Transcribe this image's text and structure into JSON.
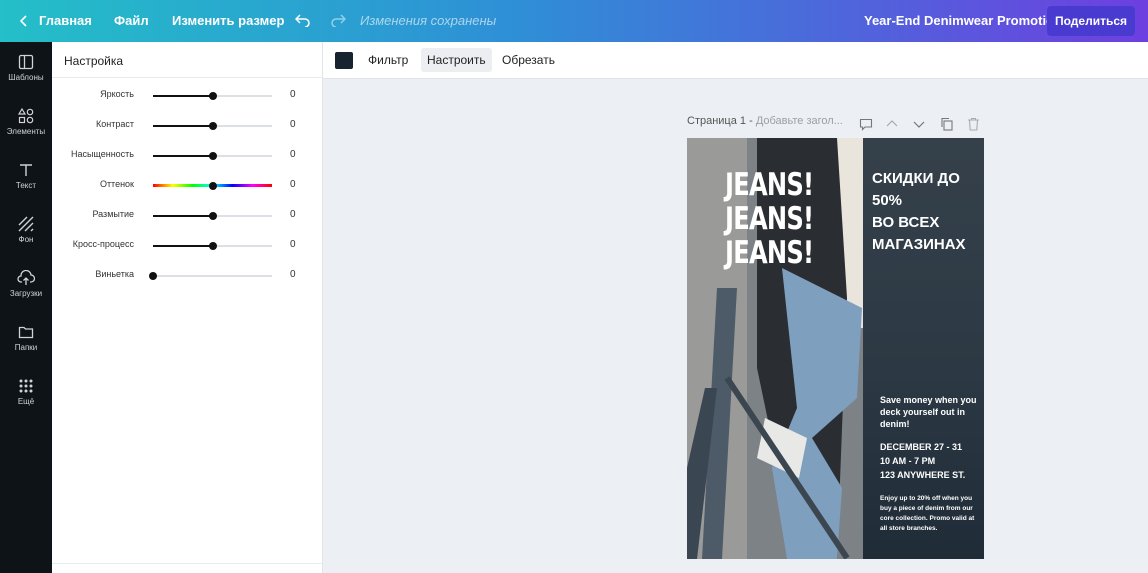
{
  "topbar": {
    "home": "Главная",
    "file": "Файл",
    "resize": "Изменить размер",
    "saved_status": "Изменения сохранены",
    "design_title": "Year-End Denimwear Promotion",
    "share": "Поделиться"
  },
  "rail": [
    {
      "label": "Шаблоны",
      "icon": "templates-icon"
    },
    {
      "label": "Элементы",
      "icon": "elements-icon"
    },
    {
      "label": "Текст",
      "icon": "text-icon"
    },
    {
      "label": "Фон",
      "icon": "background-icon"
    },
    {
      "label": "Загрузки",
      "icon": "uploads-icon"
    },
    {
      "label": "Папки",
      "icon": "folder-icon"
    },
    {
      "label": "Ещё",
      "icon": "more-icon"
    }
  ],
  "panel": {
    "title": "Настройка",
    "adjustments": [
      {
        "label": "Яркость",
        "value": "0",
        "position": 0.5
      },
      {
        "label": "Контраст",
        "value": "0",
        "position": 0.5
      },
      {
        "label": "Насыщенность",
        "value": "0",
        "position": 0.5
      },
      {
        "label": "Оттенок",
        "value": "0",
        "position": 0.5,
        "hue": true
      },
      {
        "label": "Размытие",
        "value": "0",
        "position": 0.5
      },
      {
        "label": "Кросс-процесс",
        "value": "0",
        "position": 0.5
      },
      {
        "label": "Виньетка",
        "value": "0",
        "position": 0.0
      }
    ]
  },
  "toolbar": {
    "swatch_color": "#182330",
    "filter": "Фильтр",
    "adjust": "Настроить",
    "crop": "Обрезать"
  },
  "page": {
    "label": "Страница 1 -",
    "title_placeholder": "Добавьте загол..."
  },
  "poster": {
    "jeans": [
      "JEANS!",
      "JEANS!",
      "JEANS!"
    ],
    "headline": [
      "СКИДКИ ДО",
      "50%",
      "ВО ВСЕХ",
      "МАГАЗИНАХ"
    ],
    "save_text": "Save money when you deck yourself out in denim!",
    "details": [
      "DECEMBER 27 - 31",
      "10 AM - 7 PM",
      "123 ANYWHERE ST."
    ],
    "fine_print": "Enjoy up to 20% off when you buy a piece of denim from our core collection. Promo valid at all store branches."
  },
  "colors": {
    "accent_gradient_start": "#24bfc8",
    "accent_gradient_end": "#6d3fe0",
    "share_button": "#4a3bd0",
    "rail_bg": "#0e1318"
  }
}
